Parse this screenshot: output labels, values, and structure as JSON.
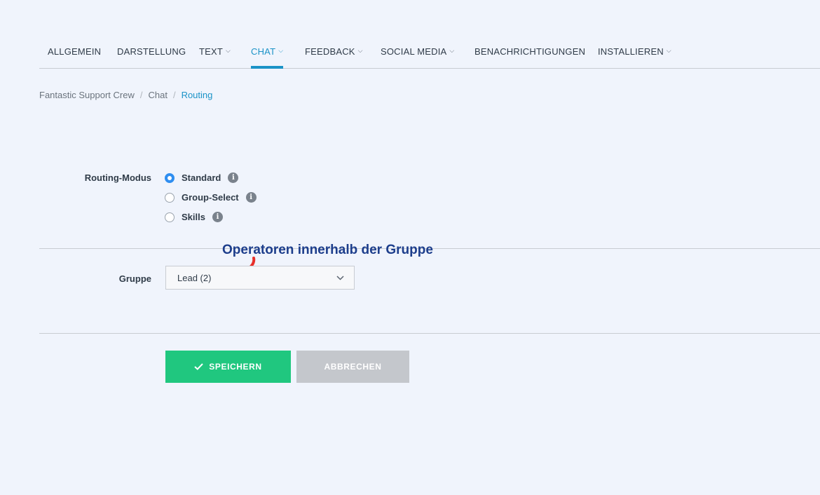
{
  "nav": {
    "tabs": [
      {
        "label": "ALLGEMEIN",
        "dropdown": false
      },
      {
        "label": "DARSTELLUNG",
        "dropdown": false
      },
      {
        "label": "TEXT",
        "dropdown": true
      },
      {
        "label": "CHAT",
        "dropdown": true,
        "active": true
      },
      {
        "label": "FEEDBACK",
        "dropdown": true
      },
      {
        "label": "SOCIAL MEDIA",
        "dropdown": true
      },
      {
        "label": "BENACHRICHTIGUNGEN",
        "dropdown": false
      },
      {
        "label": "INSTALLIEREN",
        "dropdown": true
      }
    ]
  },
  "breadcrumb": {
    "items": [
      "Fantastic Support Crew",
      "Chat",
      "Routing"
    ],
    "separator": "/"
  },
  "routing": {
    "label": "Routing-Modus",
    "options": [
      {
        "label": "Standard",
        "checked": true
      },
      {
        "label": "Group-Select",
        "checked": false
      },
      {
        "label": "Skills",
        "checked": false
      }
    ]
  },
  "group": {
    "label": "Gruppe",
    "selected": "Lead (2)"
  },
  "annotation": {
    "text": "Operatoren innerhalb der Gruppe",
    "color": "#1d3e8c",
    "arrow_color": "#e8302a"
  },
  "actions": {
    "save_label": "SPEICHERN",
    "cancel_label": "ABBRECHEN"
  },
  "icons": {
    "info": "i",
    "chevron": "⌄",
    "check": "✓"
  },
  "colors": {
    "accent": "#1b93c7",
    "save": "#20c77f",
    "cancel": "#c4c7cc",
    "background": "#f0f4fc"
  }
}
